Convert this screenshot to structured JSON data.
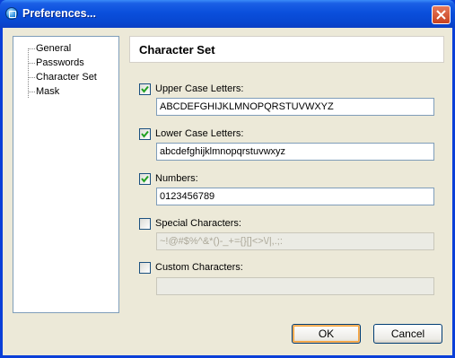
{
  "window": {
    "title": "Preferences..."
  },
  "tree": {
    "items": [
      {
        "label": "General"
      },
      {
        "label": "Passwords"
      },
      {
        "label": "Character Set"
      },
      {
        "label": "Mask"
      }
    ]
  },
  "panel": {
    "title": "Character Set",
    "options": [
      {
        "label": "Upper Case Letters:",
        "checked": true,
        "value": "ABCDEFGHIJKLMNOPQRSTUVWXYZ",
        "enabled": true
      },
      {
        "label": "Lower Case Letters:",
        "checked": true,
        "value": "abcdefghijklmnopqrstuvwxyz",
        "enabled": true
      },
      {
        "label": "Numbers:",
        "checked": true,
        "value": "0123456789",
        "enabled": true
      },
      {
        "label": "Special Characters:",
        "checked": false,
        "value": "~!@#$%^&*()-_+={}[]<>\\/|,.;:",
        "enabled": false
      },
      {
        "label": "Custom Characters:",
        "checked": false,
        "value": "",
        "enabled": false
      }
    ]
  },
  "buttons": {
    "ok": "OK",
    "cancel": "Cancel"
  }
}
